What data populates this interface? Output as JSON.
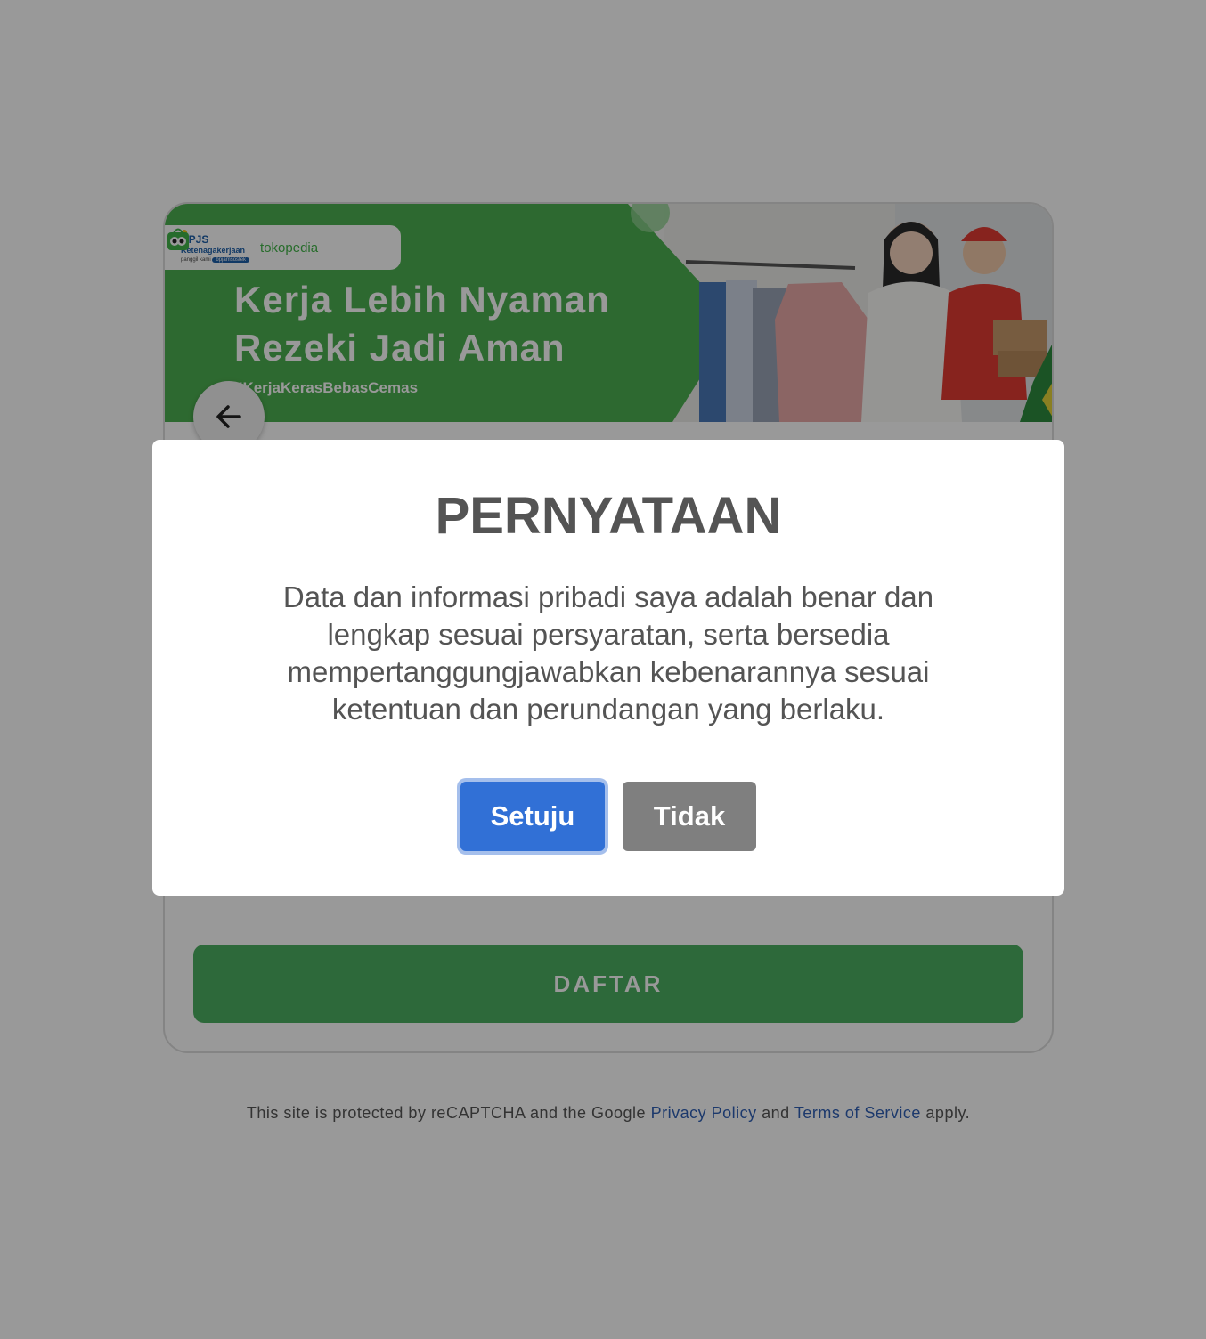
{
  "banner": {
    "bpjs_title": "BPJS",
    "bpjs_subtitle": "Ketenagakerjaan",
    "bpjs_tagline_prefix": "panggil kami",
    "bpjs_tagline_brand": "bpjamsostek",
    "tokopedia_name": "tokopedia",
    "headline_line1": "Kerja Lebih Nyaman",
    "headline_line2": "Rezeki Jadi Aman",
    "hashtag": "#KerjaKerasBebasCemas"
  },
  "navigation": {
    "back_icon": "arrow-left-icon"
  },
  "form": {
    "submit_label": "DAFTAR"
  },
  "footer": {
    "recaptcha_prefix": "This site is protected by reCAPTCHA and the Google",
    "privacy_link": "Privacy Policy",
    "and_text": "and",
    "terms_link": "Terms of Service",
    "suffix": "apply."
  },
  "modal": {
    "title": "PERNYATAAN",
    "body": "Data dan informasi pribadi saya adalah benar dan lengkap sesuai persyaratan, serta bersedia mempertanggungjawabkan kebenarannya sesuai ketentuan dan perundangan yang berlaku.",
    "agree_label": "Setuju",
    "decline_label": "Tidak"
  },
  "colors": {
    "banner_green": "#4caf50",
    "primary_blue": "#3170d6",
    "daftar_green": "#4caf62",
    "decline_gray": "#7f7f7f",
    "link_blue": "#2f5fb5"
  }
}
